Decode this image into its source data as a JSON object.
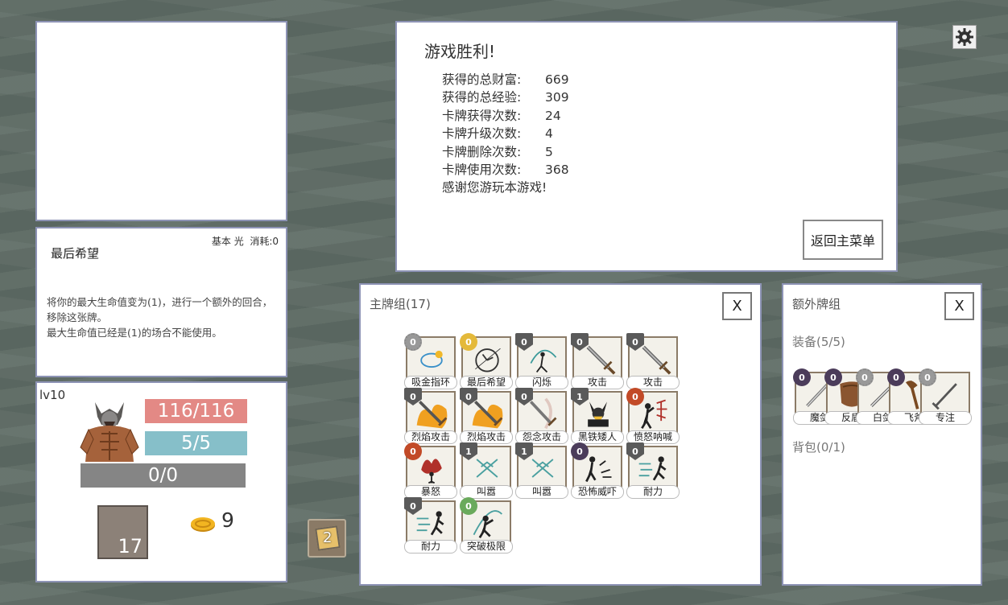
{
  "card_detail": {
    "title": "最后希望",
    "meta": "基本 光  消耗:0",
    "description": "将你的最大生命值变为(1)，进行一个额外的回合，移除这张牌。\n最大生命值已经是(1)的场合不能使用。"
  },
  "player": {
    "level": "lv10",
    "hp": "116/116",
    "mp": "5/5",
    "xp": "0/0",
    "deck_count": "17",
    "gold": "9"
  },
  "victory": {
    "title": "游戏胜利!",
    "stats": [
      {
        "label": "获得的总财富:",
        "value": "669"
      },
      {
        "label": "获得的总经验:",
        "value": "309"
      },
      {
        "label": "卡牌获得次数:",
        "value": "24"
      },
      {
        "label": "卡牌升级次数:",
        "value": "4"
      },
      {
        "label": "卡牌删除次数:",
        "value": "5"
      },
      {
        "label": "卡牌使用次数:",
        "value": "368"
      }
    ],
    "thanks": "感谢您游玩本游戏!",
    "back_button": "返回主菜单"
  },
  "discard_count": "2",
  "main_deck": {
    "title": "主牌组(17)",
    "close": "X",
    "cards": [
      {
        "name": "吸金指环",
        "cost": "0",
        "cost_type": "gear",
        "icon": "ring-icon"
      },
      {
        "name": "最后希望",
        "cost": "0",
        "cost_type": "gold",
        "icon": "last-hope-icon"
      },
      {
        "name": "闪烁",
        "cost": "0",
        "cost_type": "dark",
        "icon": "blink-icon"
      },
      {
        "name": "攻击",
        "cost": "0",
        "cost_type": "dark",
        "icon": "sword-icon"
      },
      {
        "name": "攻击",
        "cost": "0",
        "cost_type": "dark",
        "icon": "sword-icon"
      },
      {
        "name": "烈焰攻击",
        "cost": "0",
        "cost_type": "dark",
        "icon": "flame-sword-icon"
      },
      {
        "name": "烈焰攻击",
        "cost": "0",
        "cost_type": "dark",
        "icon": "flame-sword-icon"
      },
      {
        "name": "怨念攻击",
        "cost": "0",
        "cost_type": "dark",
        "icon": "grudge-sword-icon"
      },
      {
        "name": "黑铁矮人",
        "cost": "1",
        "cost_type": "dark",
        "icon": "dwarf-icon"
      },
      {
        "name": "愤怒呐喊",
        "cost": "0",
        "cost_type": "fire",
        "icon": "shout-icon"
      },
      {
        "name": "暴怒",
        "cost": "0",
        "cost_type": "fire",
        "icon": "rage-icon"
      },
      {
        "name": "叫嚣",
        "cost": "1",
        "cost_type": "dark",
        "icon": "taunt-icon"
      },
      {
        "name": "叫嚣",
        "cost": "1",
        "cost_type": "dark",
        "icon": "taunt-icon"
      },
      {
        "name": "恐怖威吓",
        "cost": "0",
        "cost_type": "moon",
        "icon": "intimidate-icon"
      },
      {
        "name": "耐力",
        "cost": "0",
        "cost_type": "dark",
        "icon": "stamina-icon"
      },
      {
        "name": "耐力",
        "cost": "0",
        "cost_type": "dark",
        "icon": "stamina-icon"
      },
      {
        "name": "突破极限",
        "cost": "0",
        "cost_type": "green",
        "icon": "breakthrough-icon"
      }
    ]
  },
  "extra_deck": {
    "title": "额外牌组",
    "close": "X",
    "equipment_label": "装备(5/5)",
    "bag_label": "背包(0/1)",
    "equipment": [
      {
        "name": "魔剑",
        "cost": "0",
        "cost_type": "moon",
        "icon": "magic-sword-icon"
      },
      {
        "name": "反盾",
        "cost": "0",
        "cost_type": "moon",
        "icon": "shield-icon"
      },
      {
        "name": "白剑",
        "cost": "0",
        "cost_type": "gear",
        "icon": "white-sword-icon"
      },
      {
        "name": "飞斧",
        "cost": "0",
        "cost_type": "moon",
        "icon": "axe-icon"
      },
      {
        "name": "专注",
        "cost": "0",
        "cost_type": "gear",
        "icon": "focus-icon"
      }
    ]
  }
}
